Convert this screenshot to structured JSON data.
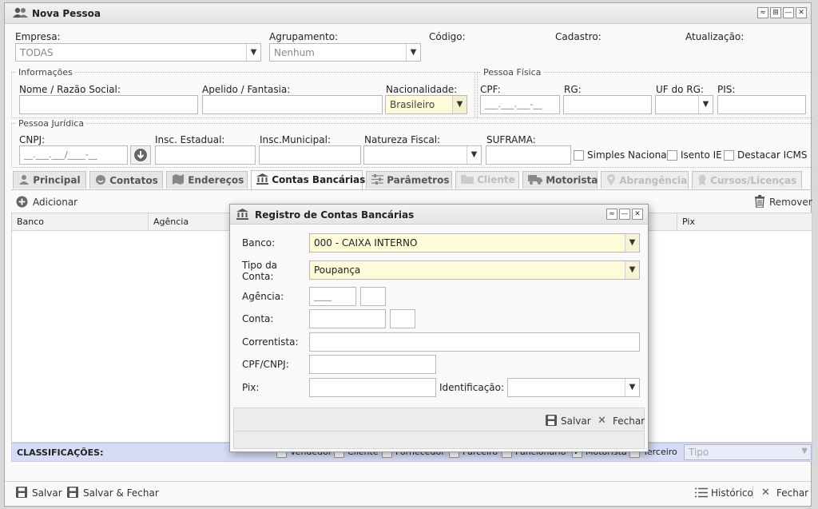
{
  "window": {
    "title": "Nova Pessoa",
    "controls": [
      "≈",
      "⊞",
      "—",
      "✕"
    ]
  },
  "header_fields": {
    "empresa_label": "Empresa:",
    "empresa_value": "TODAS",
    "agrupamento_label": "Agrupamento:",
    "agrupamento_value": "Nenhum",
    "codigo_label": "Código:",
    "cadastro_label": "Cadastro:",
    "atualizacao_label": "Atualização:"
  },
  "informacoes": {
    "legend": "Informações",
    "nome_label": "Nome / Razão Social:",
    "apelido_label": "Apelido / Fantasia:",
    "nacionalidade_label": "Nacionalidade:",
    "nacionalidade_value": "Brasileiro"
  },
  "pessoa_fisica": {
    "legend": "Pessoa Física",
    "cpf_label": "CPF:",
    "cpf_placeholder": "___.___.___-__",
    "rg_label": "RG:",
    "uf_rg_label": "UF do RG:",
    "pis_label": "PIS:"
  },
  "pessoa_juridica": {
    "legend": "Pessoa Jurídica",
    "cnpj_label": "CNPJ:",
    "cnpj_placeholder": "__.___.___/____-__",
    "insc_estadual_label": "Insc. Estadual:",
    "insc_municipal_label": "Insc.Municipal:",
    "natureza_label": "Natureza Fiscal:",
    "suframa_label": "SUFRAMA:",
    "simples_label": "Simples Nacional",
    "isento_label": "Isento IE",
    "destacar_label": "Destacar ICMS"
  },
  "tabs": [
    {
      "label": "Principal",
      "state": "normal"
    },
    {
      "label": "Contatos",
      "state": "normal"
    },
    {
      "label": "Endereços",
      "state": "normal"
    },
    {
      "label": "Contas Bancárias",
      "state": "active"
    },
    {
      "label": "Parâmetros",
      "state": "normal"
    },
    {
      "label": "Cliente",
      "state": "disabled"
    },
    {
      "label": "Motorista",
      "state": "normal"
    },
    {
      "label": "Abrangência",
      "state": "disabled"
    },
    {
      "label": "Cursos/Licenças",
      "state": "disabled"
    }
  ],
  "grid": {
    "add_label": "Adicionar",
    "remove_label": "Remover",
    "columns": [
      "Banco",
      "Agência",
      "Pix"
    ]
  },
  "classificacoes": {
    "label": "CLASSIFICAÇÕES:",
    "items": [
      {
        "label": "Vendedor",
        "checked": false
      },
      {
        "label": "Cliente",
        "checked": false
      },
      {
        "label": "Fornecedor",
        "checked": false
      },
      {
        "label": "Parceiro",
        "checked": false
      },
      {
        "label": "Funcionário",
        "checked": false
      },
      {
        "label": "Motorista",
        "checked": true
      },
      {
        "label": "Terceiro",
        "checked": false
      }
    ],
    "tipo_placeholder": "Tipo"
  },
  "footer": {
    "salvar_label": "Salvar",
    "salvar_fechar_label": "Salvar & Fechar",
    "historico_label": "Histórico",
    "fechar_label": "Fechar"
  },
  "dialog": {
    "title": "Registro de Contas Bancárias",
    "banco_label": "Banco:",
    "banco_value": "000 - CAIXA INTERNO",
    "tipo_conta_label": "Tipo da Conta:",
    "tipo_conta_value": "Poupança",
    "agencia_label": "Agência:",
    "agencia_placeholder": "____",
    "conta_label": "Conta:",
    "correntista_label": "Correntista:",
    "cpf_cnpj_label": "CPF/CNPJ:",
    "pix_label": "Pix:",
    "identificacao_label": "Identificação:",
    "salvar_label": "Salvar",
    "fechar_label": "Fechar"
  },
  "colors": {
    "highlight_yellow": "#fefbd8",
    "classif_bar": "#d6dcf5"
  }
}
